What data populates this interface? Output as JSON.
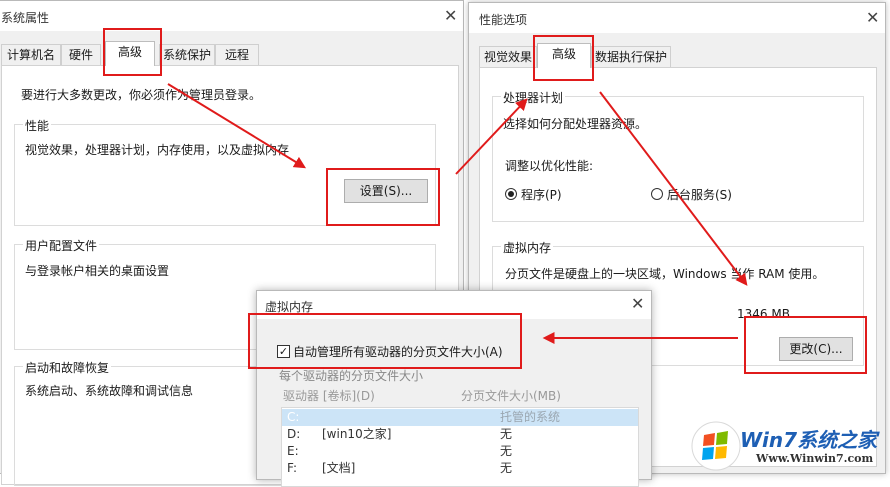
{
  "system_properties": {
    "title": "系统属性",
    "tabs": [
      {
        "label": "计算机名"
      },
      {
        "label": "硬件"
      },
      {
        "label": "高级"
      },
      {
        "label": "系统保护"
      },
      {
        "label": "远程"
      }
    ],
    "intro": "要进行大多数更改，你必须作为管理员登录。",
    "performance": {
      "label": "性能",
      "desc": "视觉效果，处理器计划，内存使用，以及虚拟内存",
      "settings_button": "设置(S)..."
    },
    "user_profiles": {
      "label": "用户配置文件",
      "desc": "与登录帐户相关的桌面设置"
    },
    "startup_recovery": {
      "label": "启动和故障恢复",
      "desc": "系统启动、系统故障和调试信息"
    }
  },
  "performance_options": {
    "title": "性能选项",
    "tabs": [
      {
        "label": "视觉效果"
      },
      {
        "label": "高级"
      },
      {
        "label": "数据执行保护"
      }
    ],
    "processor": {
      "label": "处理器计划",
      "desc": "选择如何分配处理器资源。",
      "adjust_label": "调整以优化性能:",
      "option_programs": "程序(P)",
      "option_services": "后台服务(S)",
      "selected": "程序(P)"
    },
    "virtual_memory": {
      "label": "虚拟内存",
      "desc": "分页文件是硬盘上的一块区域，Windows 当作 RAM 使用。",
      "size": "1346 MB",
      "change_button": "更改(C)..."
    }
  },
  "virtual_memory_dialog": {
    "title": "虚拟内存",
    "auto_manage_label": "自动管理所有驱动器的分页文件大小(A)",
    "auto_manage_checked": true,
    "section_label": "每个驱动器的分页文件大小",
    "col_drive": "驱动器 [卷标](D)",
    "col_size": "分页文件大小(MB)",
    "rows": [
      {
        "drive": "C:",
        "label": "",
        "size": "托管的系统"
      },
      {
        "drive": "D:",
        "label": "[win10之家]",
        "size": "无"
      },
      {
        "drive": "E:",
        "label": "",
        "size": "无"
      },
      {
        "drive": "F:",
        "label": "[文档]",
        "size": "无"
      }
    ]
  },
  "watermark": {
    "brand": "Win7系统之家",
    "url": "Www.Winwin7.com"
  },
  "annotation_color": "#e01b1b"
}
